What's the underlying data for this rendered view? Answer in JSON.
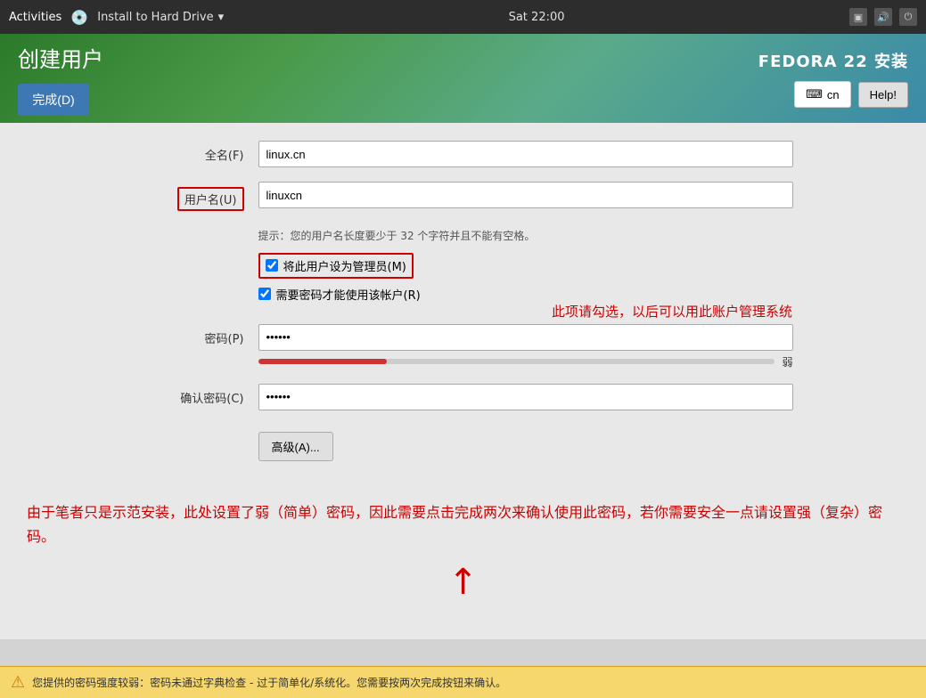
{
  "systemBar": {
    "activities": "Activities",
    "appTitle": "Install to Hard Drive",
    "time": "Sat 22:00",
    "dropdownArrow": "▾"
  },
  "header": {
    "pageTitle": "创建用户",
    "doneBtn": "完成(D)",
    "fedoraTitle": "FEDORA 22 安装",
    "langBtn": "cn",
    "helpBtn": "Help!"
  },
  "form": {
    "fullNameLabel": "全名(F)",
    "fullNameValue": "linux.cn",
    "fullNamePlaceholder": "",
    "usernameLabel": "用户名(U)",
    "usernameValue": "linuxcn",
    "usernamePlaceholder": "",
    "hint": "提示：您的用户名长度要少于 32 个字符并且不能有空格。",
    "adminCheckLabel": "将此用户设为管理员(M)",
    "requirePasswordLabel": "需要密码才能使用该帐户(R)",
    "passwordLabel": "密码(P)",
    "passwordValue": "••••••",
    "strengthLabel": "弱",
    "confirmPasswordLabel": "确认密码(C)",
    "confirmPasswordValue": "••••••",
    "advancedBtn": "高级(A)..."
  },
  "annotations": {
    "adminNote": "此项请勾选，以后可以用此账户管理系统",
    "noteText": "由于笔者只是示范安装，此处设置了弱（简单）密码，因此需要点击完成两次来确认使用此密码，若你需要安全一点请设置强（复杂）密码。"
  },
  "statusBar": {
    "warningIcon": "⚠",
    "text": "您提供的密码强度较弱：密码未通过字典检查 - 过于简单化/系统化。您需要按两次完成按钮来确认。"
  }
}
